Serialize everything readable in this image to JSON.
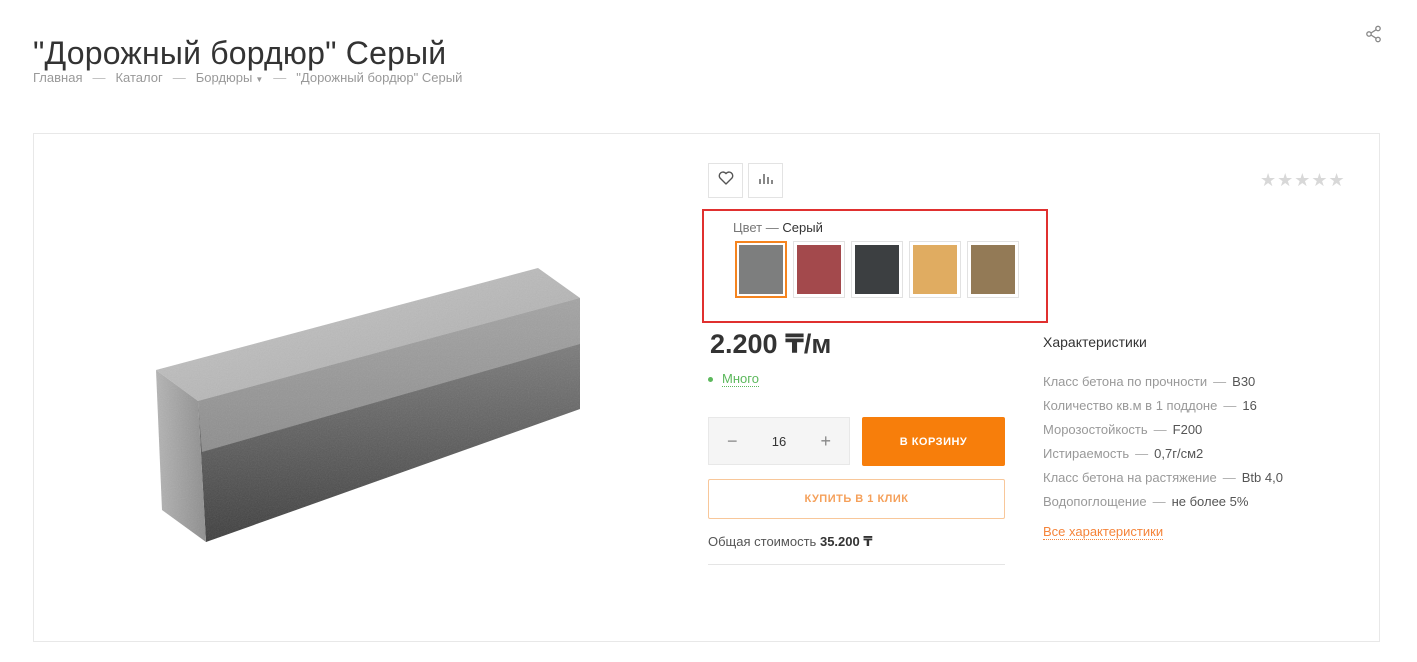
{
  "page_title": "\"Дорожный бордюр\" Серый",
  "breadcrumb": {
    "home": "Главная",
    "catalog": "Каталог",
    "category": "Бордюры",
    "current": "\"Дорожный бордюр\" Серый",
    "separator": "—"
  },
  "actions": {
    "favorite_icon": "heart-icon",
    "compare_icon": "bar-chart-icon",
    "share_icon": "share-icon"
  },
  "rating": {
    "stars_text": "★★★★★",
    "value": 0
  },
  "variant": {
    "label": "Цвет",
    "separator": "—",
    "selected": "Серый",
    "swatches": [
      {
        "color": "#7d7e7e",
        "active": true
      },
      {
        "color": "#a3494c",
        "active": false
      },
      {
        "color": "#3c3f41",
        "active": false
      },
      {
        "color": "#e0ac61",
        "active": false
      },
      {
        "color": "#937a56",
        "active": false
      }
    ]
  },
  "price": "2.200 ₸/м",
  "stock": "Много",
  "quantity": {
    "value": "16",
    "minus": "−",
    "plus": "+"
  },
  "buttons": {
    "add_to_cart": "В КОРЗИНУ",
    "buy_one_click": "КУПИТЬ В 1 КЛИК"
  },
  "total": {
    "label": "Общая стоимость",
    "value": "35.200 ₸"
  },
  "specs": {
    "title": "Характеристики",
    "separator": "—",
    "items": [
      {
        "name": "Класс бетона по прочности",
        "value": "В30"
      },
      {
        "name": "Количество кв.м в 1 поддоне",
        "value": "16"
      },
      {
        "name": "Морозостойкость",
        "value": "F200"
      },
      {
        "name": "Истираемость",
        "value": "0,7г/см2"
      },
      {
        "name": "Класс бетона на растяжение",
        "value": "Btb 4,0"
      },
      {
        "name": "Водопоглощение",
        "value": "не более 5%"
      }
    ],
    "all_link": "Все характеристики"
  },
  "colors": {
    "accent": "#f77e0b",
    "stock_green": "#5cb85c",
    "highlight_red": "#e0302f"
  }
}
